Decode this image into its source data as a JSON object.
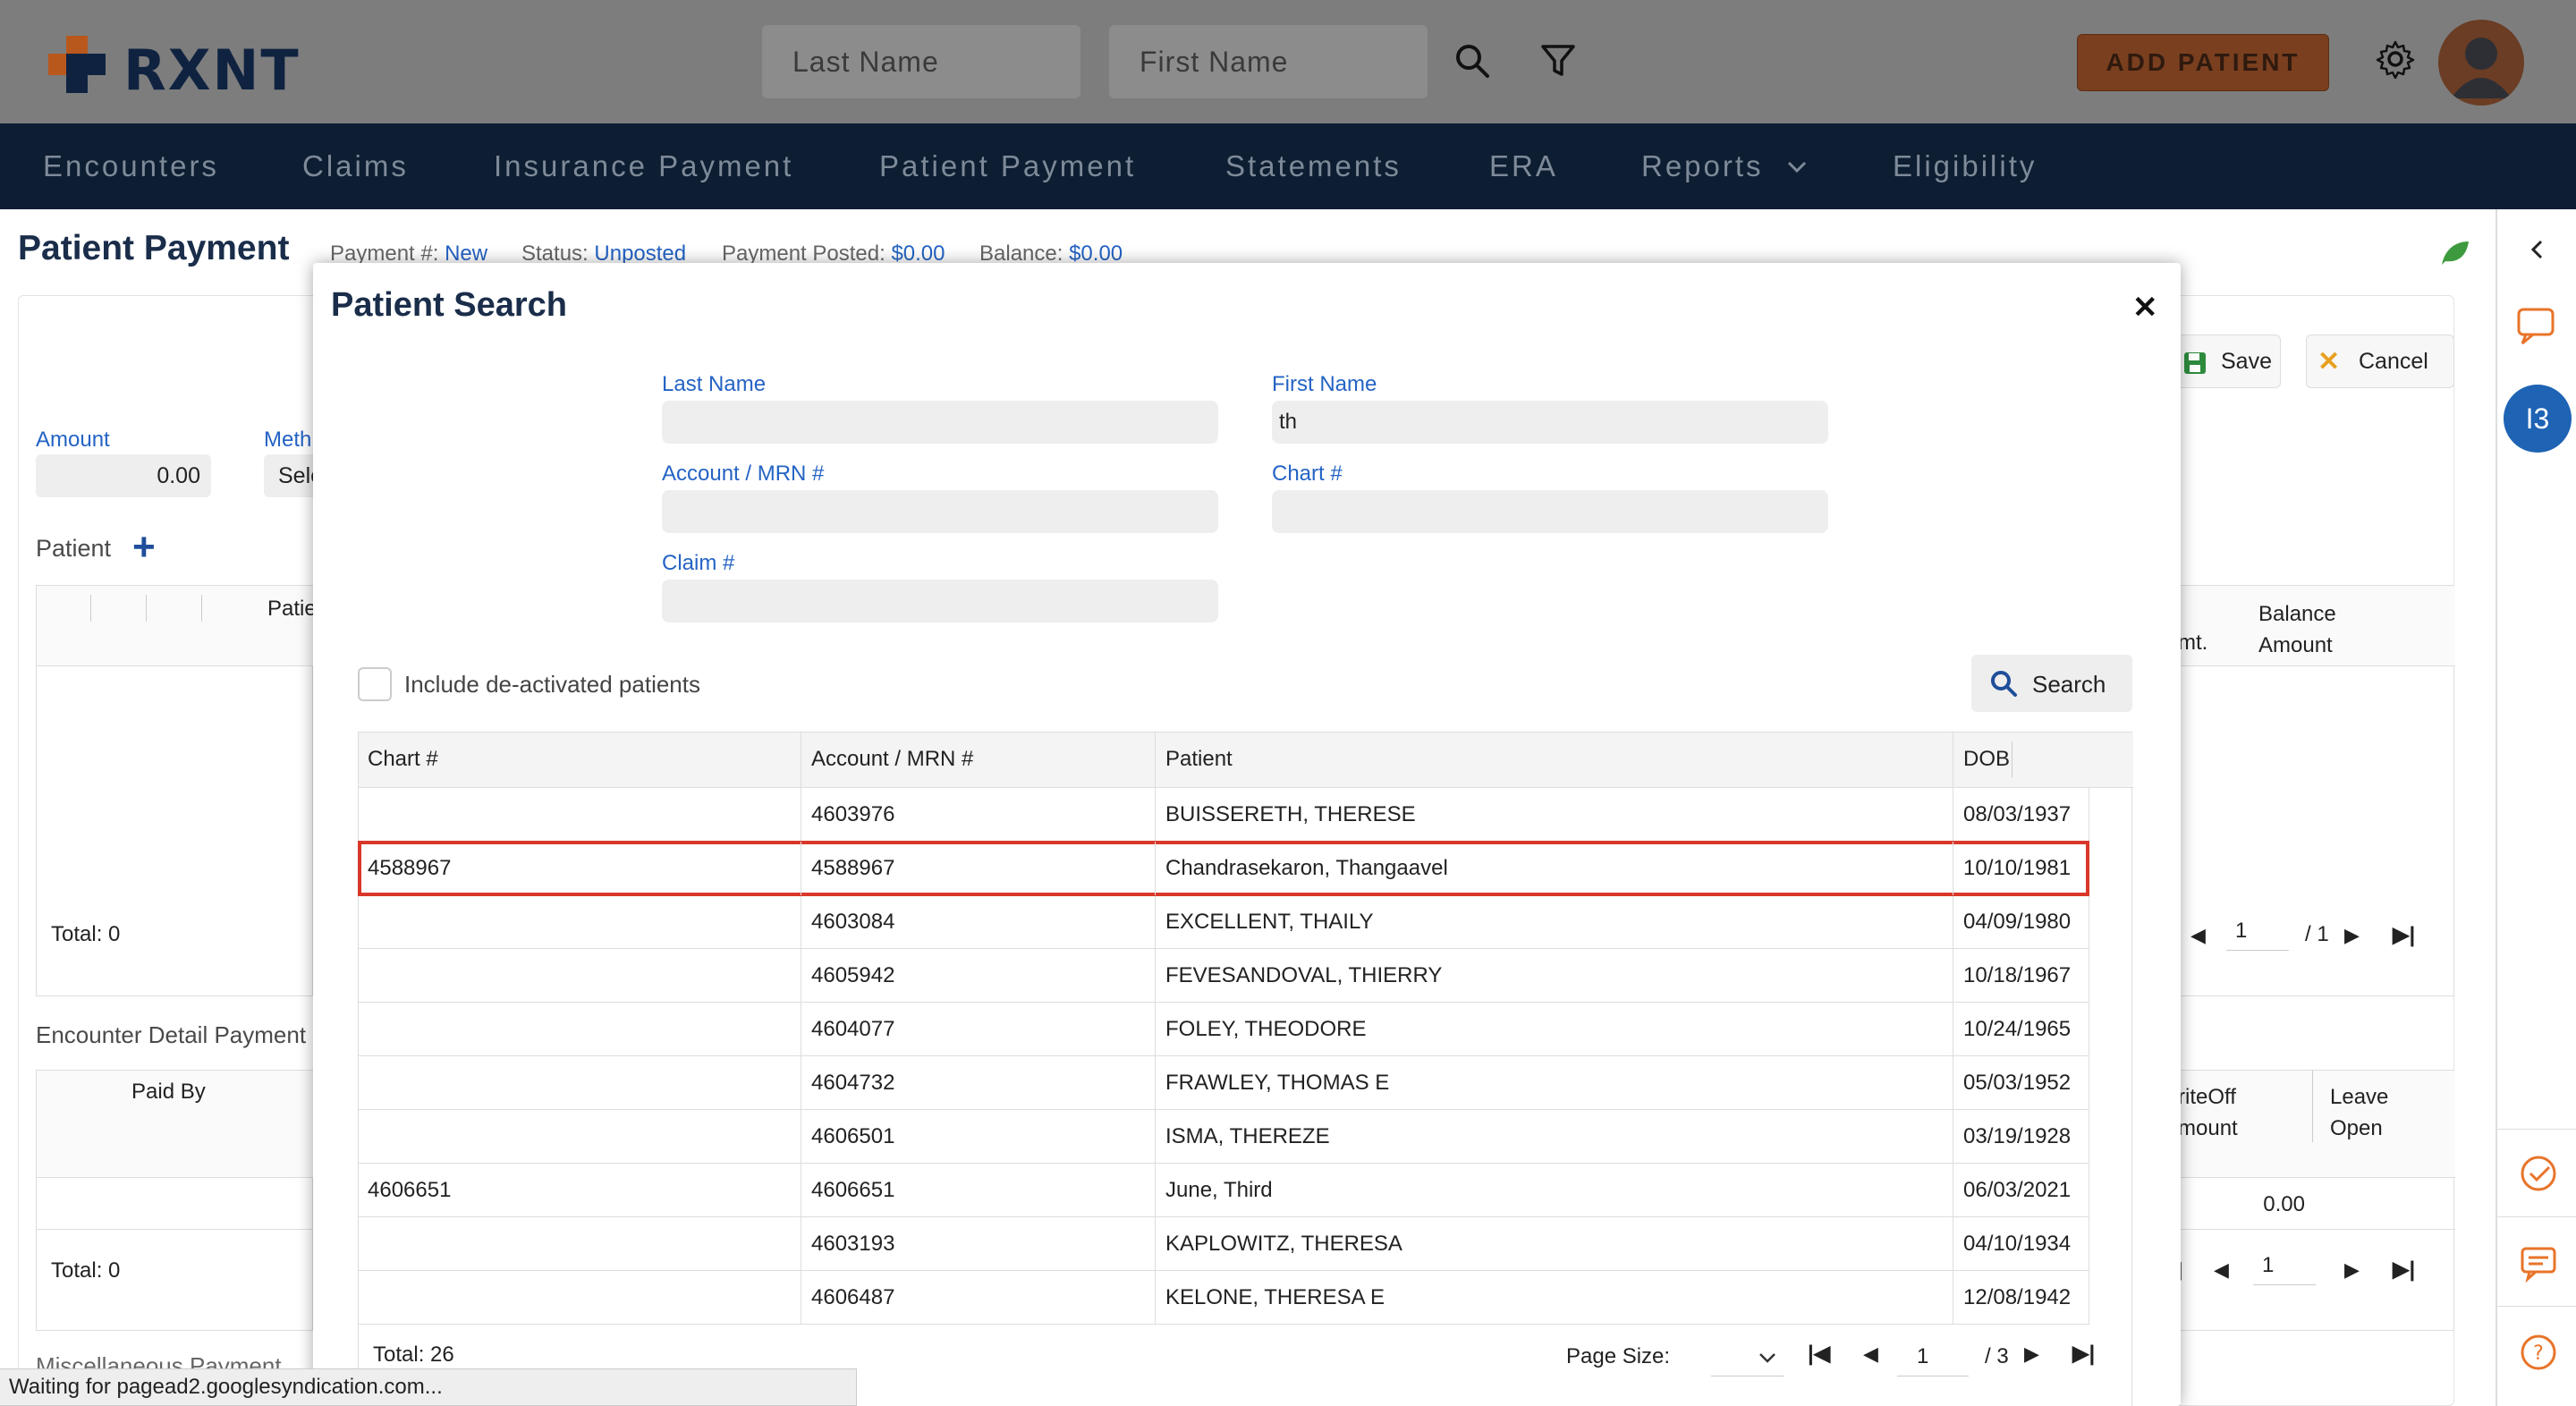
{
  "topbar": {
    "logo_text": "RXNT",
    "last_name_placeholder": "Last Name",
    "first_name_placeholder": "First Name",
    "add_patient_label": "ADD PATIENT",
    "brand_orange": "#e8742a",
    "brand_navy": "#0f2341"
  },
  "nav": {
    "items": [
      "Encounters",
      "Claims",
      "Insurance Payment",
      "Patient Payment",
      "Statements",
      "ERA",
      "Reports",
      "Eligibility"
    ]
  },
  "page": {
    "title": "Patient Payment",
    "payment_label": "Payment #:",
    "payment_value": "New",
    "status_label": "Status:",
    "status_value": "Unposted",
    "posted_label": "Payment Posted:",
    "posted_value": "$0.00",
    "balance_label": "Balance:",
    "balance_value": "$0.00",
    "save_label": "Save",
    "cancel_label": "Cancel",
    "amount_label": "Amount",
    "amount_value": "0.00",
    "method_label": "Meth",
    "method_value": "Sele",
    "patient_label": "Patient",
    "patient_col": "Patie",
    "balance_col": "Balance Amount",
    "amt_col": "mt.",
    "total_label_1": "Total: 0",
    "pager1_page": "1",
    "pager1_total": "/ 1",
    "encounter_detail_label": "Encounter Detail Payment",
    "paid_by_col": "Paid By",
    "writeoff_col": "riteOff mount",
    "leave_open_col": "Leave Open",
    "writeoff_value": "0.00",
    "total_label_2": "Total: 0",
    "pager2_page": "1",
    "misc_label": "Miscellaneous Payment",
    "badge_value": "I3"
  },
  "modal": {
    "title": "Patient Search",
    "last_name_label": "Last Name",
    "last_name_value": "",
    "first_name_label": "First Name",
    "first_name_value": "th",
    "account_label": "Account / MRN #",
    "account_value": "",
    "chart_label": "Chart #",
    "chart_value": "",
    "claim_label": "Claim #",
    "claim_value": "",
    "include_deactivated_label": "Include de-activated patients",
    "search_label": "Search",
    "columns": [
      "Chart #",
      "Account / MRN #",
      "Patient",
      "DOB"
    ],
    "rows": [
      {
        "chart": "",
        "account": "4603976",
        "patient": "BUISSERETH, THERESE",
        "dob": "08/03/1937"
      },
      {
        "chart": "4588967",
        "account": "4588967",
        "patient": "Chandrasekaron, Thangaavel",
        "dob": "10/10/1981"
      },
      {
        "chart": "",
        "account": "4603084",
        "patient": "EXCELLENT, THAILY",
        "dob": "04/09/1980"
      },
      {
        "chart": "",
        "account": "4605942",
        "patient": "FEVESANDOVAL, THIERRY",
        "dob": "10/18/1967"
      },
      {
        "chart": "",
        "account": "4604077",
        "patient": "FOLEY, THEODORE",
        "dob": "10/24/1965"
      },
      {
        "chart": "",
        "account": "4604732",
        "patient": "FRAWLEY, THOMAS E",
        "dob": "05/03/1952"
      },
      {
        "chart": "",
        "account": "4606501",
        "patient": "ISMA, THEREZE",
        "dob": "03/19/1928"
      },
      {
        "chart": "4606651",
        "account": "4606651",
        "patient": "June, Third",
        "dob": "06/03/2021"
      },
      {
        "chart": "",
        "account": "4603193",
        "patient": "KAPLOWITZ, THERESA",
        "dob": "04/10/1934"
      },
      {
        "chart": "",
        "account": "4606487",
        "patient": "KELONE, THERESA E",
        "dob": "12/08/1942"
      }
    ],
    "total_label": "Total: 26",
    "page_size_label": "Page Size:",
    "current_page": "1",
    "total_pages": "/ 3",
    "highlight_color": "#d9372a"
  },
  "status_bar": {
    "text": "Waiting for pagead2.googlesyndication.com..."
  }
}
